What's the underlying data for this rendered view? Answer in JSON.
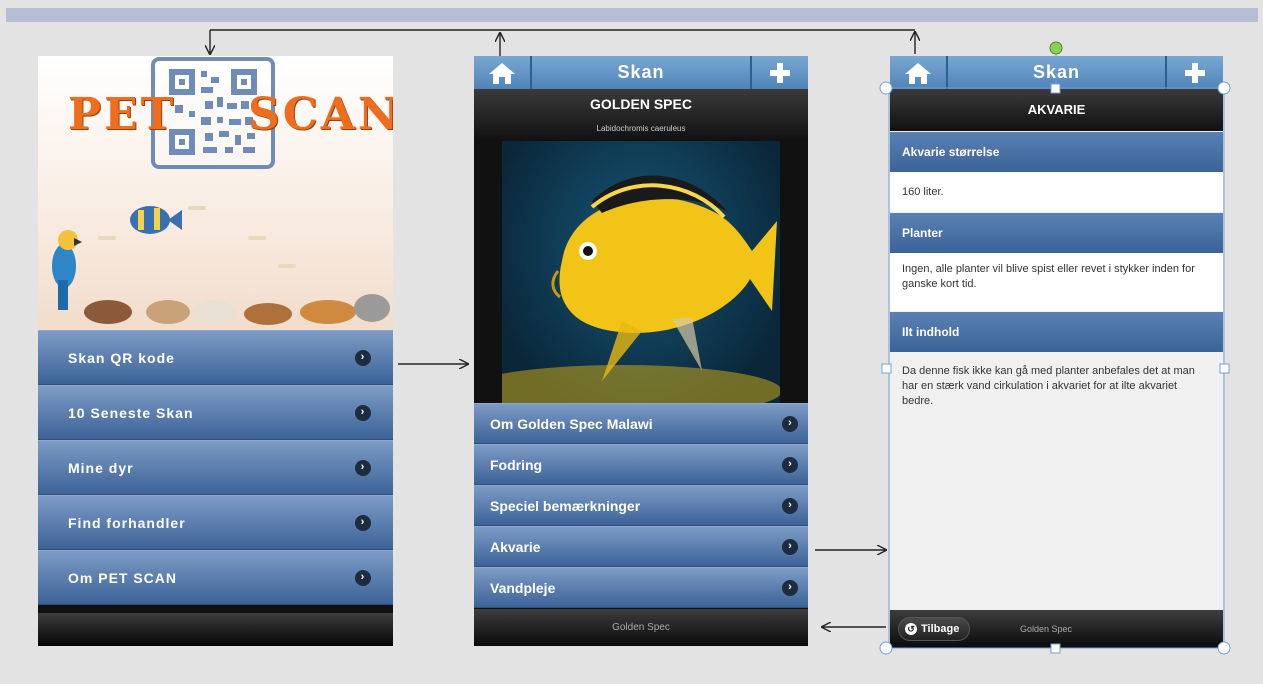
{
  "screen1": {
    "logo_part1": "PET",
    "logo_part2": "SCAN",
    "menu": [
      {
        "label": "Skan QR kode"
      },
      {
        "label": "10 Seneste Skan"
      },
      {
        "label": "Mine dyr"
      },
      {
        "label": "Find forhandler"
      },
      {
        "label": "Om PET SCAN"
      }
    ]
  },
  "screen2": {
    "header_title": "Skan",
    "title": "GOLDEN SPEC",
    "subtitle": "Labidochromis caeruleus",
    "menu": [
      {
        "label": "Om Golden Spec Malawi"
      },
      {
        "label": "Fodring"
      },
      {
        "label": "Speciel bemærkninger"
      },
      {
        "label": "Akvarie"
      },
      {
        "label": "Vandpleje"
      }
    ],
    "footer": "Golden Spec"
  },
  "screen3": {
    "header_title": "Skan",
    "title": "AKVARIE",
    "sections": [
      {
        "heading": "Akvarie størrelse",
        "text": "160 liter."
      },
      {
        "heading": "Planter",
        "text": "Ingen, alle planter vil blive spist eller revet i stykker inden for ganske kort tid."
      },
      {
        "heading": "Ilt indhold",
        "text": "Da denne fisk ikke kan gå med planter anbefales det at man har en stærk vand cirkulation i akvariet for at ilte akvariet bedre."
      }
    ],
    "back_label": "Tilbage",
    "footer": "Golden Spec"
  },
  "colors": {
    "accent": "#4f84b8",
    "logo": "#ee6d1f",
    "background": "#e3e3e3"
  },
  "icons": [
    "home-icon",
    "plus-icon",
    "chevron-right-icon",
    "qr-code-icon",
    "back-arrow-icon"
  ]
}
